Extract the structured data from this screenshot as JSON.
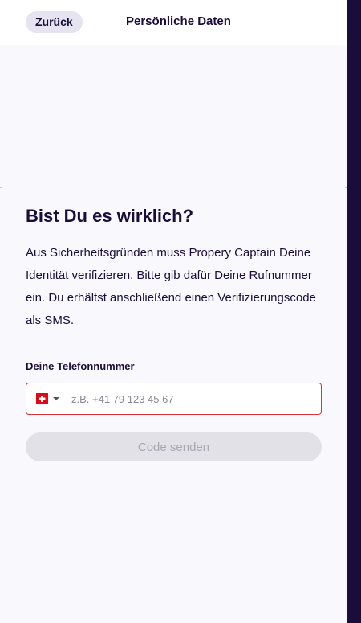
{
  "header": {
    "back_label": "Zurück",
    "title": "Persönliche Daten"
  },
  "content": {
    "heading": "Bist Du es wirklich?",
    "description": "Aus Sicherheitsgründen muss Propery Captain Deine Identität verifizieren. Bitte gib dafür Deine Rufnummer ein. Du erhältst anschließend einen Verifizierungscode als SMS."
  },
  "phone": {
    "label": "Deine Telefonnummer",
    "country_icon": "swiss-flag-icon",
    "value": "",
    "placeholder": "z.B. +41 79 123 45 67"
  },
  "actions": {
    "send_label": "Code senden"
  },
  "colors": {
    "brand_dark": "#1a0d3a",
    "background": "#f8f8fd",
    "error_border": "#e0313b",
    "disabled_button": "#e2e1e8",
    "flag_red": "#e30613"
  }
}
